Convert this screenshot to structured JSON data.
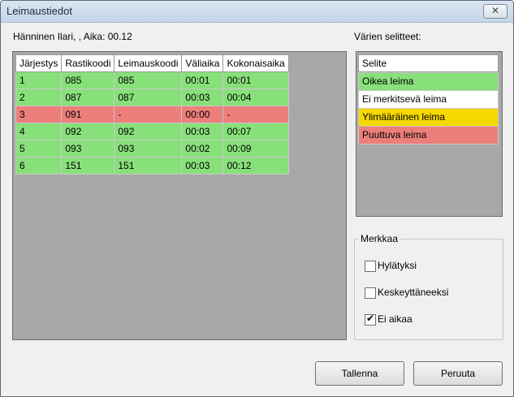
{
  "window": {
    "title": "Leimaustiedot",
    "close_glyph": "✕"
  },
  "runner_info": "Hänninen Ilari, ,  Aika: 00.12",
  "table": {
    "headers": [
      "Järjestys",
      "Rastikoodi",
      "Leimauskoodi",
      "Väliaika",
      "Kokonaisaika"
    ],
    "rows": [
      [
        "1",
        "085",
        "085",
        "00:01",
        "00:01"
      ],
      [
        "2",
        "087",
        "087",
        "00:03",
        "00:04"
      ],
      [
        "3",
        "091",
        "-",
        "00:00",
        "-"
      ],
      [
        "4",
        "092",
        "092",
        "00:03",
        "00:07"
      ],
      [
        "5",
        "093",
        "093",
        "00:02",
        "00:09"
      ],
      [
        "6",
        "151",
        "151",
        "00:03",
        "00:12"
      ]
    ]
  },
  "legend": {
    "title": "Värien selitteet:",
    "header": "Selite",
    "items": [
      {
        "label": "Oikea leima",
        "color": "#88e07a"
      },
      {
        "label": "Ei merkitsevä leima",
        "color": "#ffffff"
      },
      {
        "label": "Ylimääräinen leima",
        "color": "#f5d800"
      },
      {
        "label": "Puuttuva leima",
        "color": "#ec7f7a"
      }
    ]
  },
  "mark": {
    "title": "Merkkaa",
    "options": [
      {
        "label": "Hylätyksi",
        "checked": false
      },
      {
        "label": "Keskeyttäneeksi",
        "checked": false
      },
      {
        "label": "Ei aikaa",
        "checked": true
      }
    ]
  },
  "buttons": {
    "save": "Tallenna",
    "cancel": "Peruuta"
  }
}
